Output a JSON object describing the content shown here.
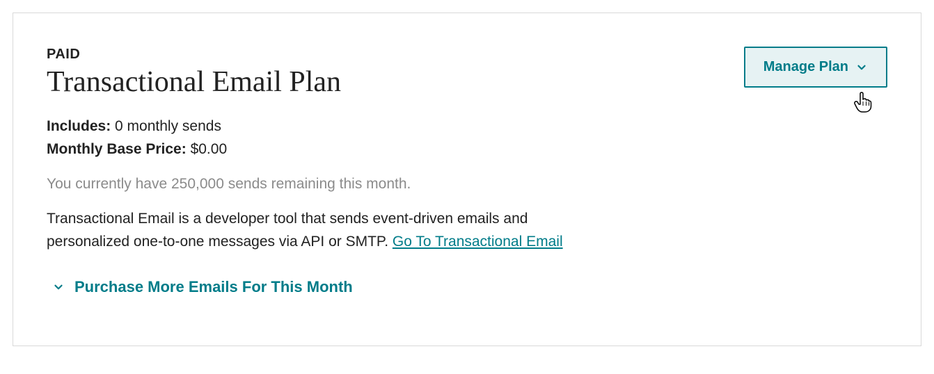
{
  "plan": {
    "badge": "PAID",
    "title": "Transactional Email Plan",
    "includes_label": "Includes:",
    "includes_value": "0 monthly sends",
    "price_label": "Monthly Base Price:",
    "price_value": "$0.00",
    "remaining_text": "You currently have 250,000 sends remaining this month.",
    "description_text": "Transactional Email is a developer tool that sends event-driven emails and personalized one-to-one messages via API or SMTP. ",
    "description_link": "Go To Transactional Email",
    "purchase_more_label": "Purchase More Emails For This Month",
    "manage_button_label": "Manage Plan"
  },
  "colors": {
    "accent": "#007c89",
    "muted": "#8b8b8b",
    "border": "#d9d9d9"
  }
}
